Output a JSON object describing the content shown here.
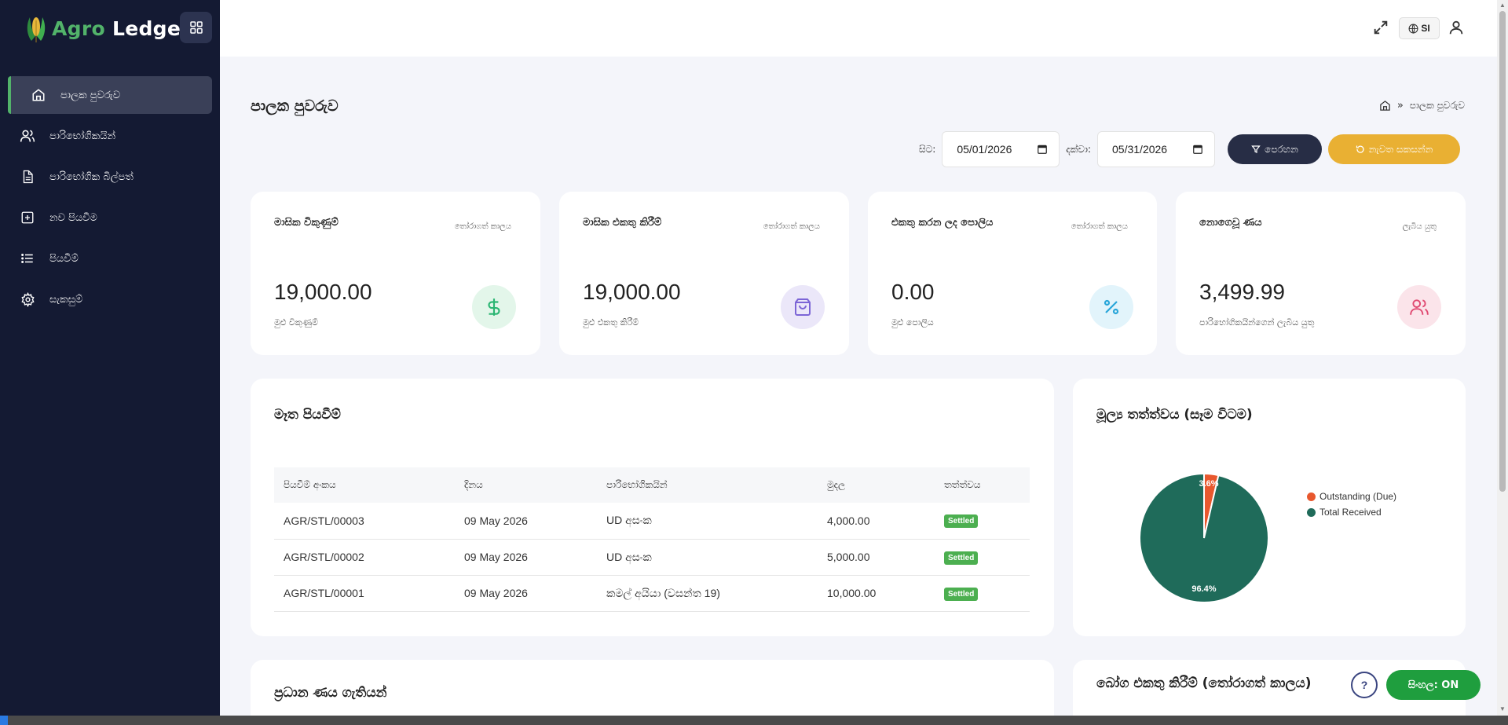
{
  "app": {
    "brand_part1": "Agro",
    "brand_part2": "Ledger"
  },
  "sidebar": {
    "items": [
      {
        "label": "පාලක පුවරුව",
        "icon": "home-icon",
        "active": true
      },
      {
        "label": "පාරිභෝගිකයින්",
        "icon": "users-icon"
      },
      {
        "label": "පාරිභෝගික බිල්පත්",
        "icon": "document-icon"
      },
      {
        "label": "නව පියවීම",
        "icon": "plus-square-icon"
      },
      {
        "label": "පියවීම්",
        "icon": "list-icon"
      },
      {
        "label": "සැකසුම්",
        "icon": "gear-icon"
      }
    ]
  },
  "topbar": {
    "lang": "SI"
  },
  "page": {
    "title": "පාලක පුවරුව",
    "breadcrumb": "පාලක පුවරුව"
  },
  "filters": {
    "from_label": "සිට:",
    "from_value": "05/01/2026",
    "to_label": "දක්වා:",
    "to_value": "05/31/2026",
    "filter_label": "පෙරහන",
    "reset_label": "නැවත සකසන්න"
  },
  "stats": [
    {
      "title": "මාසික විකුණුම්",
      "tag": "තෝරාගත් කාලය",
      "value": "19,000.00",
      "sub": "මුළු විකුණුම්",
      "icon": "dollar-icon",
      "color": "#2bb673",
      "bg": "#e3f6ea"
    },
    {
      "title": "මාසික එකතු කිරීම්",
      "tag": "තෝරාගත් කාලය",
      "value": "19,000.00",
      "sub": "මුළු එකතු කිරීම්",
      "icon": "shopping-bag-icon",
      "color": "#7c65d6",
      "bg": "#ebe7f9"
    },
    {
      "title": "එකතු කරන ලද පොලිය",
      "tag": "තෝරාගත් කාලය",
      "value": "0.00",
      "sub": "මුළු පොලිය",
      "icon": "percent-icon",
      "color": "#29a6d9",
      "bg": "#e2f4fb"
    },
    {
      "title": "නොගෙවූ ණය",
      "tag": "ලැබිය යුතු",
      "value": "3,499.99",
      "sub": "පාරිභෝගිකයින්ගෙන් ලැබිය යුතු",
      "icon": "users-icon",
      "color": "#e04a72",
      "bg": "#fbe4ea"
    }
  ],
  "recent": {
    "title": "මෑත පියවීම්",
    "columns": [
      "පියවීම් අංකය",
      "දිනය",
      "පාරිභෝගිකයින්",
      "මුදල",
      "තත්ත්වය"
    ],
    "rows": [
      {
        "no": "AGR/STL/00003",
        "date": "09 May 2026",
        "customer": "UD අසංක",
        "amount": "4,000.00",
        "status": "Settled"
      },
      {
        "no": "AGR/STL/00002",
        "date": "09 May 2026",
        "customer": "UD අසංක",
        "amount": "5,000.00",
        "status": "Settled"
      },
      {
        "no": "AGR/STL/00001",
        "date": "09 May 2026",
        "customer": "කමල් අයියා (වසන්ත 19)",
        "amount": "10,000.00",
        "status": "Settled"
      }
    ]
  },
  "status_chart": {
    "title": "මූල්‍ය තත්ත්වය (සෑම විටම)"
  },
  "chart_data": {
    "type": "pie",
    "labels": [
      "Outstanding (Due)",
      "Total Received"
    ],
    "values": [
      3.6,
      96.4
    ],
    "value_labels": [
      "3.6%",
      "96.4%"
    ],
    "colors": [
      "#e8582e",
      "#1f6b5a"
    ],
    "legend": "right"
  },
  "debtors": {
    "title": "ප්‍රධාන ණය ගැතියන්"
  },
  "collections": {
    "title": "බෝග එකතු කිරීම් (තෝරාගත් කාලය)"
  },
  "footer": {
    "help": "?",
    "sinhala": "සිංහල: ON"
  }
}
